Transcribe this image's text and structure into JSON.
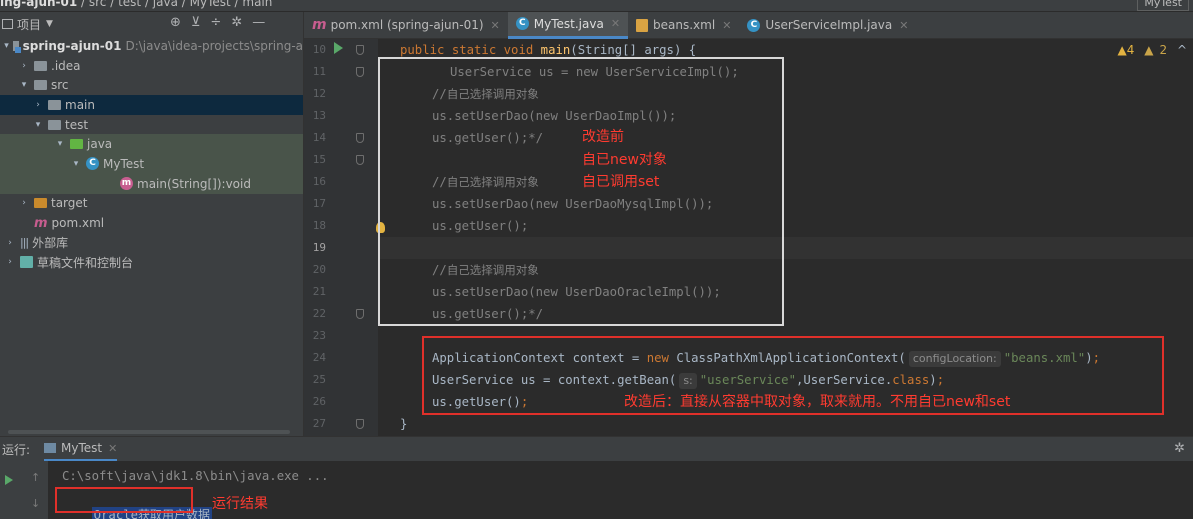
{
  "navbar": {
    "crumbs": [
      "ing-ajun-01",
      "src",
      "test",
      "java",
      "MyTest",
      "main"
    ],
    "run_config": "MyTest"
  },
  "project": {
    "header": "项目",
    "tree": [
      {
        "label": "spring-ajun-01",
        "hint": "D:\\java\\idea-projects\\spring-a",
        "arrow": "▾",
        "indent": 4,
        "icon": "module-folder-icon"
      },
      {
        "label": ".idea",
        "arrow": "›",
        "indent": 18,
        "icon": "folder-icon"
      },
      {
        "label": "src",
        "arrow": "▾",
        "indent": 18,
        "icon": "folder-icon"
      },
      {
        "label": "main",
        "arrow": "›",
        "indent": 32,
        "icon": "folder-icon",
        "selected": true
      },
      {
        "label": "test",
        "arrow": "▾",
        "indent": 32,
        "icon": "folder-icon"
      },
      {
        "label": "java",
        "arrow": "▾",
        "indent": 54,
        "icon": "test-folder-icon",
        "test": true
      },
      {
        "label": "MyTest",
        "arrow": "▾",
        "indent": 70,
        "icon": "class-icon",
        "test": true
      },
      {
        "label": "main(String[]):void",
        "arrow": "",
        "indent": 104,
        "icon": "method-icon",
        "test": true
      },
      {
        "label": "target",
        "arrow": "›",
        "indent": 18,
        "icon": "excluded-folder-icon"
      },
      {
        "label": "pom.xml",
        "arrow": "",
        "indent": 18,
        "icon": "maven-icon"
      },
      {
        "label": "外部库",
        "arrow": "›",
        "indent": 4,
        "icon": "library-icon"
      },
      {
        "label": "草稿文件和控制台",
        "arrow": "›",
        "indent": 4,
        "icon": "scratch-icon"
      }
    ]
  },
  "tabs": [
    {
      "label": "pom.xml (spring-ajun-01)",
      "icon": "maven-icon",
      "active": false,
      "closable": true
    },
    {
      "label": "MyTest.java",
      "icon": "class-icon",
      "active": true,
      "closable": true
    },
    {
      "label": "beans.xml",
      "icon": "xml-icon",
      "active": false,
      "closable": true
    },
    {
      "label": "UserServiceImpl.java",
      "icon": "class-icon",
      "active": false,
      "closable": true
    }
  ],
  "editor": {
    "line_numbers": [
      "10",
      "11",
      "12",
      "13",
      "14",
      "15",
      "16",
      "17",
      "18",
      "19",
      "20",
      "21",
      "22",
      "23",
      "24",
      "25",
      "26",
      "27"
    ],
    "current_line": "19",
    "warnings": {
      "warn_count": "4",
      "weak_count": "2"
    },
    "annotations": {
      "before_1": "改造前",
      "before_2": "自已new对象",
      "before_3": "自已调用set",
      "after": "改造后：直接从容器中取对象，取来就用。不用自已new和set"
    }
  },
  "run": {
    "label": "运行:",
    "tab": "MyTest",
    "cmd": "C:\\soft\\java\\jdk1.8\\bin\\java.exe ...",
    "output_prefix": "Oracle",
    "output_cn": "获取用户数据",
    "result_label": "运行结果"
  },
  "colors": {
    "accent": "#4a88c7",
    "annotation_red": "#ff3b30",
    "keyword": "#cc7832",
    "string": "#6a8759",
    "comment": "#808080"
  }
}
